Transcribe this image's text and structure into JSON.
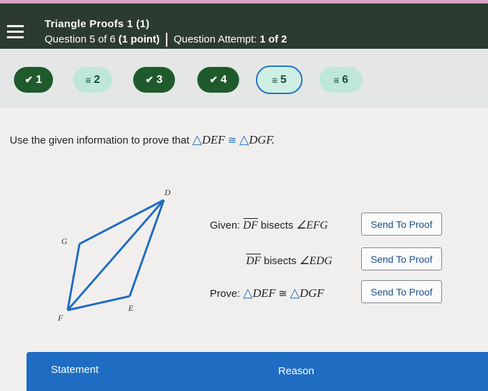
{
  "header": {
    "title": "Triangle Proofs 1 (1)",
    "question": "Question 5 of 6",
    "points": "(1 point)",
    "attempt_label": "Question Attempt:",
    "attempt_value": "1 of 2"
  },
  "nav": [
    {
      "label": "1",
      "status": "done",
      "icon": "check-icon"
    },
    {
      "label": "2",
      "status": "pending",
      "icon": "flag-icon"
    },
    {
      "label": "3",
      "status": "done",
      "icon": "check-icon"
    },
    {
      "label": "4",
      "status": "done",
      "icon": "check-icon"
    },
    {
      "label": "5",
      "status": "current",
      "icon": "flag-icon"
    },
    {
      "label": "6",
      "status": "pending",
      "icon": "flag-icon"
    }
  ],
  "prompt": {
    "text": "Use the given information to prove that",
    "tri1": "DEF",
    "tri2": "DGF."
  },
  "diagram": {
    "labels": {
      "D": "D",
      "G": "G",
      "F": "F",
      "E": "E"
    }
  },
  "given": {
    "label": "Given:",
    "seg1": "DF",
    "bisects": "bisects",
    "angle1": "EFG",
    "seg2": "DF",
    "angle2": "EDG"
  },
  "prove": {
    "label": "Prove:",
    "tri1": "DEF",
    "tri2": "DGF"
  },
  "buttons": {
    "send1": "Send To Proof",
    "send2": "Send To Proof",
    "send3": "Send To Proof"
  },
  "table": {
    "statement": "Statement",
    "reason": "Reason"
  },
  "colors": {
    "header_bg": "#2b3b2f",
    "done_pill": "#1f5a2c",
    "pending_pill": "#bfe7d9",
    "accent_blue": "#1f6dc2"
  }
}
